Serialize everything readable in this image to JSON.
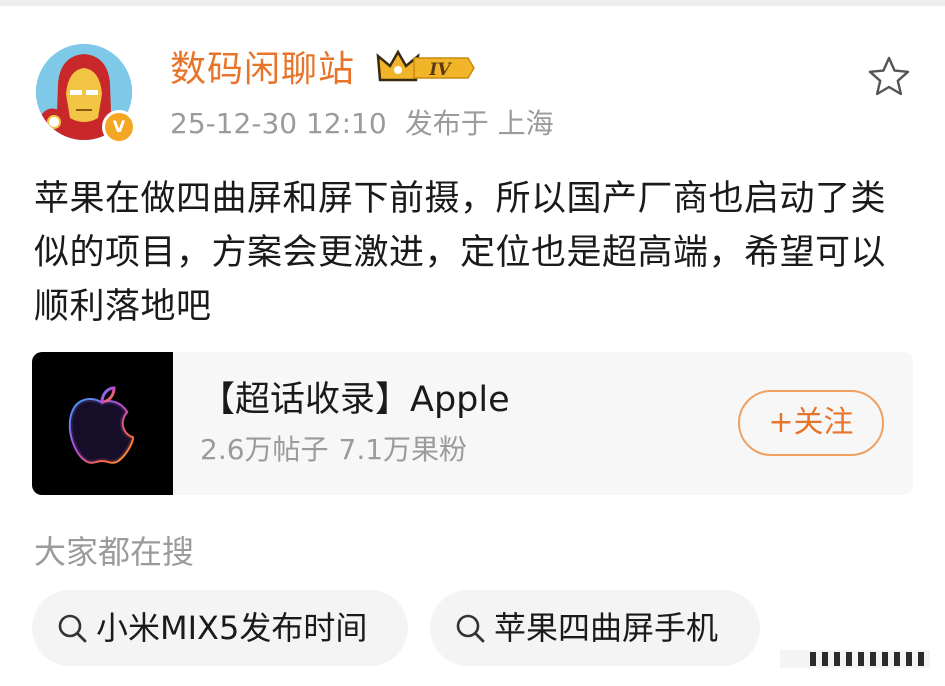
{
  "author": {
    "name": "数码闲聊站",
    "level_label": "IV",
    "verified_label": "V",
    "timestamp": "25-12-30 12:10",
    "location": "发布于 上海"
  },
  "post": {
    "text": "苹果在做四曲屏和屏下前摄，所以国产厂商也启动了类似的项目，方案会更激进，定位也是超高端，希望可以顺利落地吧"
  },
  "supertopic": {
    "title": "【超话收录】Apple",
    "posts_count": "2.6万帖子",
    "fans_count": "7.1万果粉",
    "follow_label": "+关注"
  },
  "search": {
    "heading": "大家都在搜",
    "items": [
      {
        "label": "小米MIX5发布时间"
      },
      {
        "label": "苹果四曲屏手机"
      }
    ]
  },
  "colors": {
    "accent": "#e8742a",
    "muted_text": "#9b9b9b",
    "body_text": "#1a1a1a",
    "card_bg": "#f7f7f7"
  },
  "icons": {
    "favorite": "star-outline-icon",
    "search": "magnifier-icon",
    "level": "crown-icon"
  }
}
